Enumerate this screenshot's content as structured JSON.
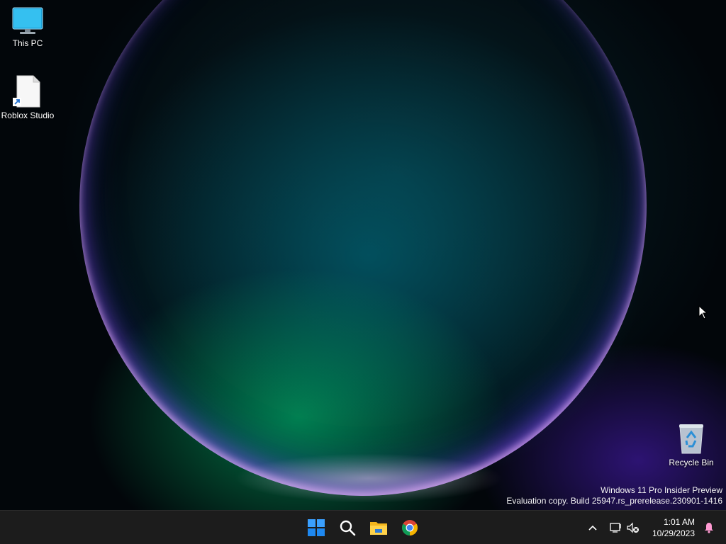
{
  "desktop": {
    "icons": [
      {
        "label": "This PC"
      },
      {
        "label": "Roblox Studio"
      },
      {
        "label": "Recycle Bin"
      }
    ],
    "watermark": {
      "line1": "Windows 11 Pro Insider Preview",
      "line2": "Evaluation copy. Build 25947.rs_prerelease.230901-1416"
    }
  },
  "taskbar": {
    "apps": [
      {
        "icon": "windows-start-icon"
      },
      {
        "icon": "search-icon"
      },
      {
        "icon": "file-explorer-icon"
      },
      {
        "icon": "chrome-icon"
      }
    ],
    "tray": {
      "time": "1:01 AM",
      "date": "10/29/2023"
    }
  },
  "colors": {
    "taskbar_bg": "#1c1c1c",
    "windows_blue": "#1e90ff",
    "notification_pink": "#ff9ad2"
  }
}
